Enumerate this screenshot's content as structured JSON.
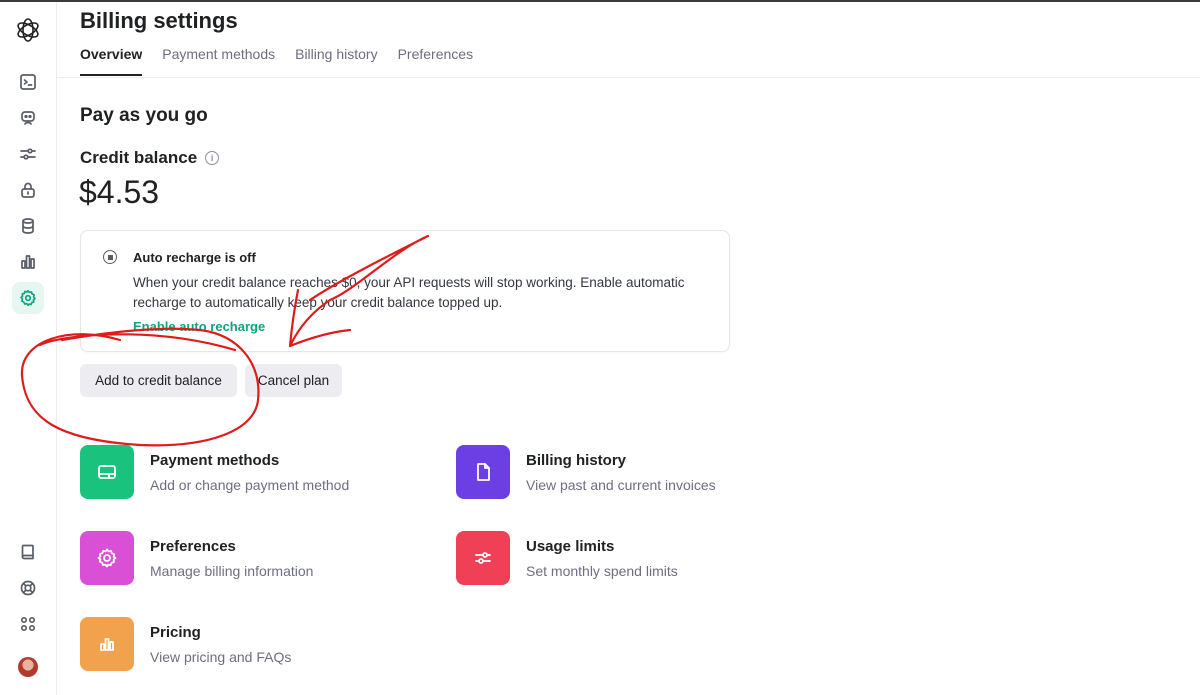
{
  "header": {
    "title": "Billing settings",
    "tabs": [
      {
        "label": "Overview",
        "active": true
      },
      {
        "label": "Payment methods",
        "active": false
      },
      {
        "label": "Billing history",
        "active": false
      },
      {
        "label": "Preferences",
        "active": false
      }
    ]
  },
  "sidebar": {
    "logo_icon": "openai-logo-icon",
    "top_items": [
      "terminal-icon",
      "assistant-bot-icon",
      "sliders-icon",
      "lock-icon",
      "database-icon",
      "bar-chart-icon",
      "settings-gear-icon"
    ],
    "active_item": "settings-gear-icon",
    "bottom_items": [
      "book-icon",
      "help-lifebuoy-icon",
      "apps-grid-icon"
    ],
    "avatar": "user-avatar"
  },
  "main": {
    "section_title": "Pay as you go",
    "credit_label": "Credit balance",
    "balance": "$4.53",
    "auto_recharge": {
      "title": "Auto recharge is off",
      "description": "When your credit balance reaches $0, your API requests will stop working. Enable automatic recharge to automatically keep your credit balance topped up.",
      "link": "Enable auto recharge"
    },
    "buttons": {
      "add": "Add to credit balance",
      "cancel": "Cancel plan"
    },
    "tiles": [
      {
        "title": "Payment methods",
        "subtitle": "Add or change payment method",
        "color": "#19c37d",
        "icon": "credit-card-icon"
      },
      {
        "title": "Billing history",
        "subtitle": "View past and current invoices",
        "color": "#6b3fe3",
        "icon": "document-icon"
      },
      {
        "title": "Preferences",
        "subtitle": "Manage billing information",
        "color": "#d94fd6",
        "icon": "gear-icon"
      },
      {
        "title": "Usage limits",
        "subtitle": "Set monthly spend limits",
        "color": "#ef4055",
        "icon": "sliders-icon"
      },
      {
        "title": "Pricing",
        "subtitle": "View pricing and FAQs",
        "color": "#f2a24c",
        "icon": "bar-chart-icon"
      }
    ]
  },
  "annotation_color": "#e01b1b"
}
